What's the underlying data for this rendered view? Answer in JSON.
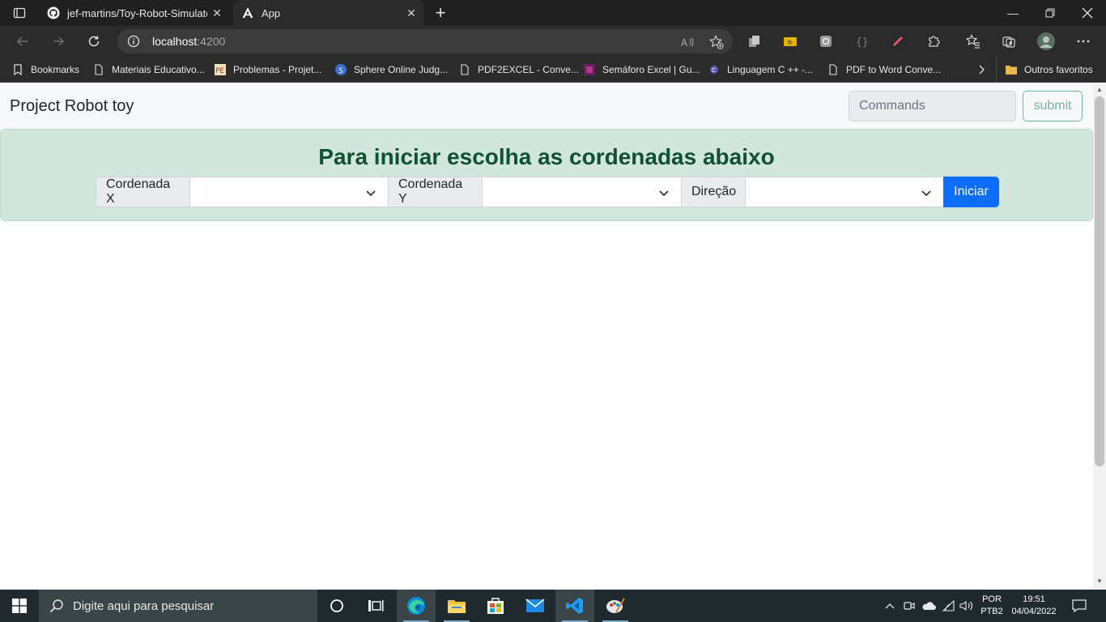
{
  "browser": {
    "tabs": [
      {
        "title": "jef-martins/Toy-Robot-Simulator",
        "icon": "github-icon"
      },
      {
        "title": "App",
        "icon": "angular-icon"
      }
    ],
    "url_host": "localhost",
    "url_port": ":4200",
    "bookmarks": [
      {
        "label": "Bookmarks",
        "icon": "bookmark-icon"
      },
      {
        "label": "Materiais Educativo...",
        "icon": "page-icon"
      },
      {
        "label": "Problemas - Projet...",
        "icon": "pe-icon"
      },
      {
        "label": "Sphere Online Judg...",
        "icon": "sphere-icon"
      },
      {
        "label": "PDF2EXCEL - Conve...",
        "icon": "page-icon"
      },
      {
        "label": "Semáforo Excel | Gu...",
        "icon": "excel-icon"
      },
      {
        "label": "Linguagem C ++ -...",
        "icon": "c-icon"
      },
      {
        "label": "PDF to Word Conve...",
        "icon": "page-icon"
      }
    ],
    "other_bookmarks": "Outros favoritos"
  },
  "app": {
    "brand": "Project Robot toy",
    "commands_placeholder": "Commands",
    "submit_label": "submit",
    "alert_title": "Para iniciar escolha as cordenadas abaixo",
    "label_x": "Cordenada X",
    "label_y": "Cordenada Y",
    "label_dir": "Direção",
    "start_label": "Iniciar"
  },
  "taskbar": {
    "search_placeholder": "Digite aqui para pesquisar",
    "lang_top": "POR",
    "lang_bottom": "PTB2",
    "time": "19:51",
    "date": "04/04/2022"
  },
  "colors": {
    "alert_bg": "#d1e7dd",
    "alert_text": "#0f5132",
    "primary": "#0d6efd",
    "success": "#198754"
  }
}
